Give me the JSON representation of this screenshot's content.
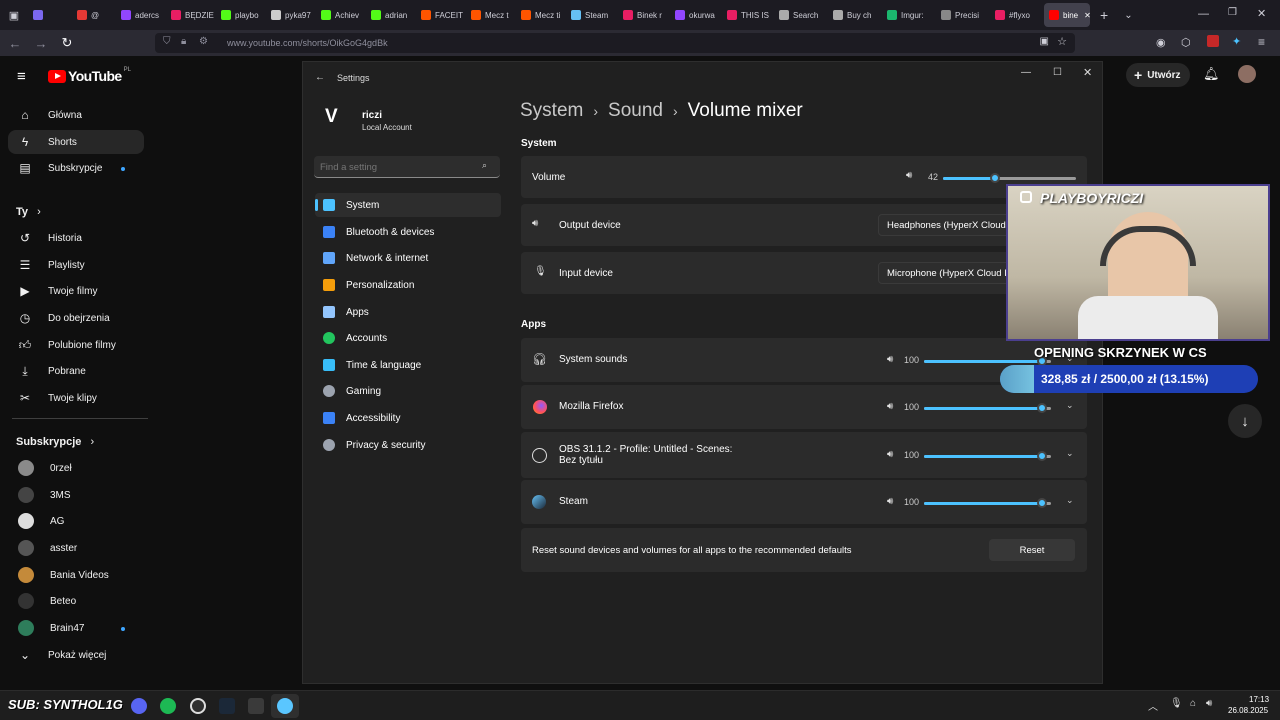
{
  "browser": {
    "tabs": [
      {
        "label": "",
        "color": "#7b68ee"
      },
      {
        "label": "@",
        "color": "#e53935"
      },
      {
        "label": "adercs",
        "color": "#9146ff"
      },
      {
        "label": "BĘDZIE",
        "color": "#e91e63"
      },
      {
        "label": "playbo",
        "color": "#53fc18"
      },
      {
        "label": "pyka97",
        "color": "#cccccc"
      },
      {
        "label": "Achiev",
        "color": "#53fc18"
      },
      {
        "label": "adrian",
        "color": "#53fc18"
      },
      {
        "label": "FACEIT",
        "color": "#ff5500"
      },
      {
        "label": "Mecz t",
        "color": "#ff5500"
      },
      {
        "label": "Mecz ti",
        "color": "#ff5500"
      },
      {
        "label": "Steam",
        "color": "#66c0f4"
      },
      {
        "label": "Binek r",
        "color": "#e91e63"
      },
      {
        "label": "okurwa",
        "color": "#9146ff"
      },
      {
        "label": "THIS IS",
        "color": "#e91e63"
      },
      {
        "label": "Search",
        "color": "#aaaaaa"
      },
      {
        "label": "Buy ch",
        "color": "#aaaaaa"
      },
      {
        "label": "Imgur:",
        "color": "#1bb76e"
      },
      {
        "label": "Precisi",
        "color": "#888888"
      },
      {
        "label": "#flyxo",
        "color": "#e91e63"
      },
      {
        "label": "bine",
        "color": "#ff0000"
      }
    ],
    "url": "www.youtube.com/shorts/OikGoG4gdBk"
  },
  "youtube": {
    "logo": "YouTube",
    "country": "PL",
    "create_label": "Utwórz",
    "nav": [
      {
        "label": "Główna",
        "icon": "home-icon"
      },
      {
        "label": "Shorts",
        "icon": "shorts-icon"
      },
      {
        "label": "Subskrypcje",
        "icon": "subscriptions-icon"
      }
    ],
    "you_header": "Ty",
    "you_items": [
      {
        "label": "Historia",
        "icon": "history-icon"
      },
      {
        "label": "Playlisty",
        "icon": "playlists-icon"
      },
      {
        "label": "Twoje filmy",
        "icon": "your-videos-icon"
      },
      {
        "label": "Do obejrzenia",
        "icon": "watch-later-icon"
      },
      {
        "label": "Polubione filmy",
        "icon": "liked-icon"
      },
      {
        "label": "Pobrane",
        "icon": "download-icon"
      },
      {
        "label": "Twoje klipy",
        "icon": "clips-icon"
      }
    ],
    "subs_header": "Subskrypcje",
    "subs": [
      {
        "label": "0rzeł",
        "color": "#8a8a8a"
      },
      {
        "label": "3MS",
        "color": "#444444"
      },
      {
        "label": "AG",
        "color": "#dddddd"
      },
      {
        "label": "asster",
        "color": "#555555"
      },
      {
        "label": "Bania Videos",
        "color": "#c48a3a"
      },
      {
        "label": "Beteo",
        "color": "#333333"
      },
      {
        "label": "Brain47",
        "color": "#2e7d5b"
      }
    ],
    "show_more": "Pokaż więcej"
  },
  "settings": {
    "title": "Settings",
    "user_name": "riczi",
    "user_type": "Local Account",
    "avatar_letter": "V",
    "search_placeholder": "Find a setting",
    "nav": [
      {
        "label": "System",
        "color": "#4cc2ff"
      },
      {
        "label": "Bluetooth & devices",
        "color": "#3b82f6"
      },
      {
        "label": "Network & internet",
        "color": "#60a5fa"
      },
      {
        "label": "Personalization",
        "color": "#f59e0b"
      },
      {
        "label": "Apps",
        "color": "#93c5fd"
      },
      {
        "label": "Accounts",
        "color": "#22c55e"
      },
      {
        "label": "Time & language",
        "color": "#38bdf8"
      },
      {
        "label": "Gaming",
        "color": "#9ca3af"
      },
      {
        "label": "Accessibility",
        "color": "#3b82f6"
      },
      {
        "label": "Privacy & security",
        "color": "#9ca3af"
      }
    ],
    "breadcrumb": [
      "System",
      "Sound",
      "Volume mixer"
    ],
    "system_header": "System",
    "volume_label": "Volume",
    "volume_value": "42",
    "volume_level": 0.42,
    "output_label": "Output device",
    "output_value": "Headphones (HyperX Cloud II",
    "input_label": "Input device",
    "input_value": "Microphone (HyperX Cloud II",
    "apps_header": "Apps",
    "apps": [
      {
        "name": "System sounds",
        "volume": "100",
        "level": 1.0,
        "icon": "headphones-icon"
      },
      {
        "name": "Mozilla Firefox",
        "volume": "100",
        "level": 1.0,
        "icon": "firefox-icon"
      },
      {
        "name": "OBS 31.1.2 - Profile: Untitled - Scenes: Bez tytułu",
        "volume": "100",
        "level": 1.0,
        "icon": "obs-icon"
      },
      {
        "name": "Steam",
        "volume": "100",
        "level": 1.0,
        "icon": "steam-icon"
      }
    ],
    "reset_text": "Reset sound devices and volumes for all apps to the recommended defaults",
    "reset_button": "Reset"
  },
  "overlay": {
    "handle": "PLAYBOYRICZI",
    "title": "OPENING SKRZYNEK W CS",
    "goal": "328,85 zł / 2500,00 zł (13.15%)",
    "goal_progress": 0.1315
  },
  "taskbar": {
    "sub_text": "SUB: SYNTHOL1G",
    "time": "17:13",
    "date": "26.08.2025"
  }
}
